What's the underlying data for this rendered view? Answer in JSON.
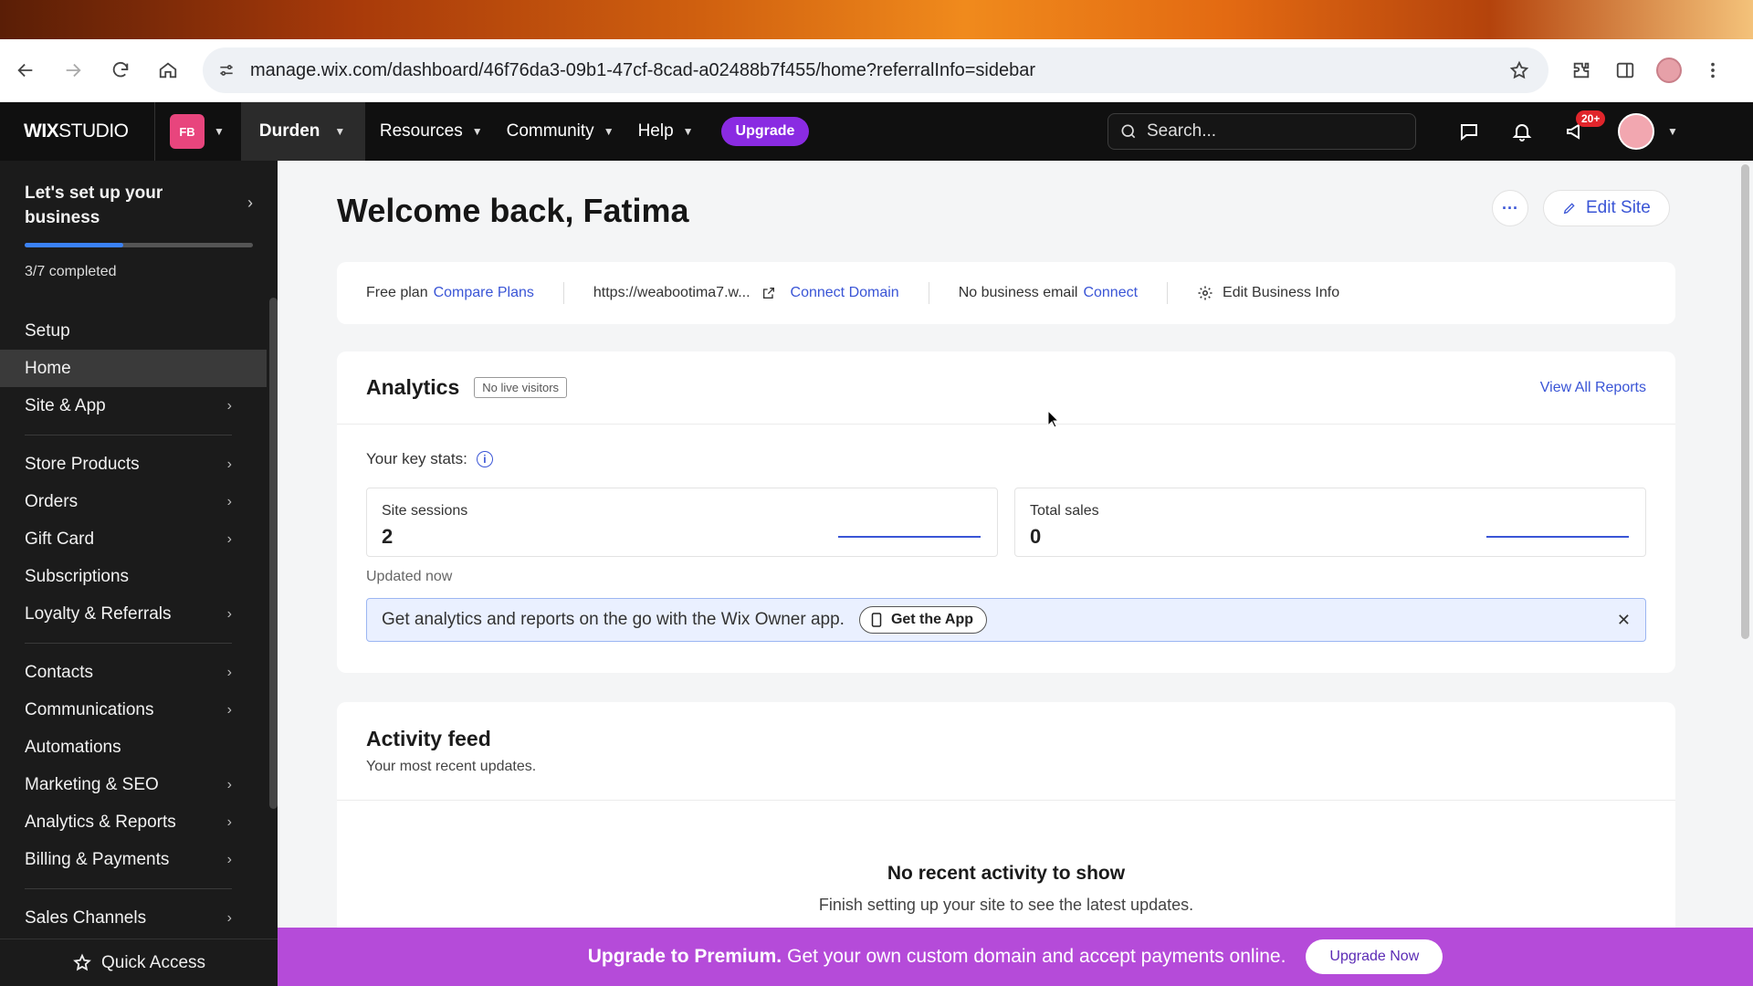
{
  "browser": {
    "url": "manage.wix.com/dashboard/46f76da3-09b1-47cf-8cad-a02488b7f455/home?referralInfo=sidebar"
  },
  "topnav": {
    "logo_bold": "WIX",
    "logo_light": "STUDIO",
    "workspace_badge": "FB",
    "site_name": "Durden",
    "menu": [
      "Resources",
      "Community",
      "Help"
    ],
    "upgrade_label": "Upgrade",
    "search_placeholder": "Search...",
    "notification_count": "20+"
  },
  "sidebar": {
    "setup_title": "Let's set up your business",
    "setup_progress": 0.43,
    "setup_completed": "3/7 completed",
    "groups": [
      [
        {
          "label": "Setup",
          "arrow": false,
          "active": false
        },
        {
          "label": "Home",
          "arrow": false,
          "active": true
        },
        {
          "label": "Site & App",
          "arrow": true,
          "active": false
        }
      ],
      [
        {
          "label": "Store Products",
          "arrow": true,
          "active": false
        },
        {
          "label": "Orders",
          "arrow": true,
          "active": false
        },
        {
          "label": "Gift Card",
          "arrow": true,
          "active": false
        },
        {
          "label": "Subscriptions",
          "arrow": false,
          "active": false
        },
        {
          "label": "Loyalty & Referrals",
          "arrow": true,
          "active": false
        }
      ],
      [
        {
          "label": "Contacts",
          "arrow": true,
          "active": false
        },
        {
          "label": "Communications",
          "arrow": true,
          "active": false
        },
        {
          "label": "Automations",
          "arrow": false,
          "active": false
        },
        {
          "label": "Marketing & SEO",
          "arrow": true,
          "active": false
        },
        {
          "label": "Analytics & Reports",
          "arrow": true,
          "active": false
        },
        {
          "label": "Billing & Payments",
          "arrow": true,
          "active": false
        }
      ],
      [
        {
          "label": "Sales Channels",
          "arrow": true,
          "active": false
        }
      ]
    ],
    "quick_access": "Quick Access"
  },
  "main": {
    "welcome": "Welcome back, Fatima",
    "more_label": "···",
    "edit_site": "Edit Site",
    "info_bar": {
      "plan": "Free plan",
      "compare_plans": "Compare Plans",
      "site_url": "https://weabootima7.w...",
      "connect_domain": "Connect Domain",
      "email_status": "No business email",
      "connect": "Connect",
      "edit_business": "Edit Business Info"
    },
    "analytics": {
      "title": "Analytics",
      "live_badge": "No live visitors",
      "view_all": "View All Reports",
      "key_stats": "Your key stats:",
      "stats": [
        {
          "label": "Site sessions",
          "value": "2"
        },
        {
          "label": "Total sales",
          "value": "0"
        }
      ],
      "updated": "Updated now",
      "app_banner": "Get analytics and reports on the go with the Wix Owner app.",
      "get_app": "Get the App"
    },
    "activity": {
      "title": "Activity feed",
      "subtitle": "Your most recent updates.",
      "empty_title": "No recent activity to show",
      "empty_sub": "Finish setting up your site to see the latest updates."
    }
  },
  "premium": {
    "bold": "Upgrade to Premium.",
    "text": "Get your own custom domain and accept payments online.",
    "button": "Upgrade Now"
  },
  "colors": {
    "accent": "#3a55d6",
    "upgrade_purple": "#8a2be2",
    "premium_bar": "#b54bd9",
    "sidebar_bg": "#1b1b1b",
    "nav_bg": "#101010"
  }
}
